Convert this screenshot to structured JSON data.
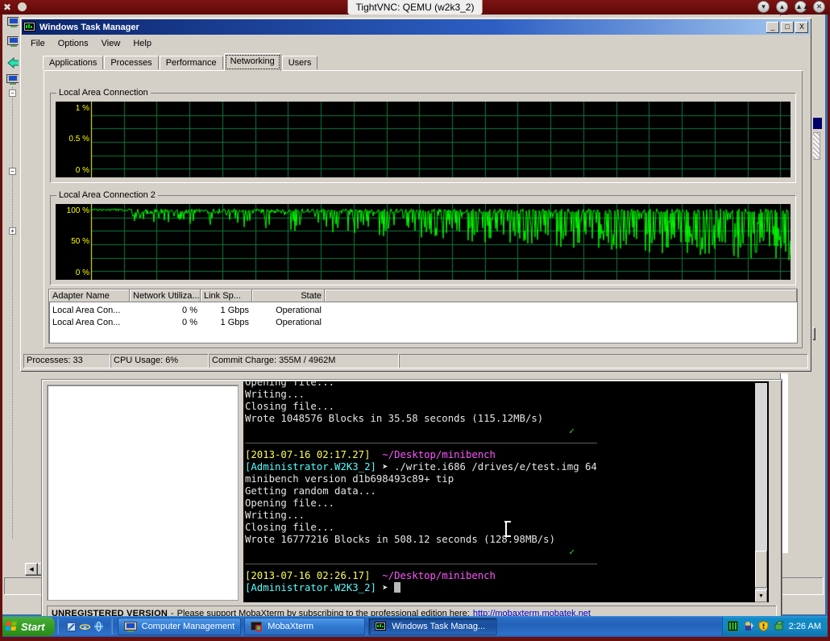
{
  "vnc": {
    "title": "TightVNC: QEMU (w2k3_2)",
    "buttons": [
      {
        "name": "minimize-icon",
        "glyph": "⌄"
      },
      {
        "name": "restore-icon",
        "glyph": "⌃"
      },
      {
        "name": "fullscreen-icon",
        "glyph": "»"
      },
      {
        "name": "close-icon",
        "glyph": "✕"
      }
    ]
  },
  "taskmgr": {
    "title": "Windows Task Manager",
    "window_buttons": [
      "_",
      "□",
      "X"
    ],
    "menus": [
      "File",
      "Options",
      "View",
      "Help"
    ],
    "tabs": [
      {
        "label": "Applications",
        "active": false
      },
      {
        "label": "Processes",
        "active": false
      },
      {
        "label": "Performance",
        "active": false
      },
      {
        "label": "Networking",
        "active": true
      },
      {
        "label": "Users",
        "active": false
      }
    ],
    "graphs": [
      {
        "title": "Local Area Connection",
        "axis_labels": [
          "1 %",
          "0.5 %",
          "0 %"
        ]
      },
      {
        "title": "Local Area Connection 2",
        "axis_labels": [
          "100 %",
          "50 %",
          "0 %"
        ]
      }
    ],
    "adapter_table": {
      "columns": [
        "Adapter Name",
        "Network Utiliza...",
        "Link Sp...",
        "State",
        ""
      ],
      "rows": [
        [
          "Local Area Con...",
          "0 %",
          "1 Gbps",
          "Operational",
          ""
        ],
        [
          "Local Area Con...",
          "0 %",
          "1 Gbps",
          "Operational",
          ""
        ]
      ]
    },
    "status": [
      "Processes: 33",
      "CPU Usage: 6%",
      "Commit Charge: 355M / 4962M",
      ""
    ]
  },
  "terminal": {
    "lines": [
      {
        "segments": [
          {
            "text": "Opening file...",
            "color": "white"
          }
        ]
      },
      {
        "segments": [
          {
            "text": "Writing...",
            "color": "white"
          }
        ]
      },
      {
        "segments": [
          {
            "text": "Closing file...",
            "color": "white"
          }
        ]
      },
      {
        "segments": [
          {
            "text": "Wrote 1048576 Blocks in 35.58 seconds (115.12MB/s)",
            "color": "white"
          }
        ]
      },
      {
        "segments": [],
        "tick": true
      },
      {
        "separator": true
      },
      {
        "segments": [
          {
            "text": "[2013-07-16 02:17.27]",
            "color": "yellow"
          },
          {
            "text": "  ",
            "color": "white"
          },
          {
            "text": "~/Desktop/minibench",
            "color": "magenta"
          }
        ]
      },
      {
        "segments": [
          {
            "text": "[Administrator.W2K3_2]",
            "color": "cyan"
          },
          {
            "text": " ➤ ",
            "color": "white"
          },
          {
            "text": "./write.i686 /drives/e/test.img 64",
            "color": "white"
          }
        ]
      },
      {
        "segments": [
          {
            "text": "minibench version d1b698493c89+ tip",
            "color": "white"
          }
        ]
      },
      {
        "segments": [
          {
            "text": "Getting random data...",
            "color": "white"
          }
        ]
      },
      {
        "segments": [
          {
            "text": "Opening file...",
            "color": "white"
          }
        ]
      },
      {
        "segments": [
          {
            "text": "Writing...",
            "color": "white"
          }
        ]
      },
      {
        "segments": [
          {
            "text": "Closing file...",
            "color": "white"
          }
        ]
      },
      {
        "segments": [
          {
            "text": "Wrote 16777216 Blocks in 508.12 seconds (128.98MB/s)",
            "color": "white"
          }
        ]
      },
      {
        "segments": [],
        "tick": true
      },
      {
        "separator": true
      },
      {
        "segments": [
          {
            "text": "[2013-07-16 02:26.17]",
            "color": "yellow"
          },
          {
            "text": "  ",
            "color": "white"
          },
          {
            "text": "~/Desktop/minibench",
            "color": "magenta"
          }
        ]
      },
      {
        "segments": [
          {
            "text": "[Administrator.W2K3_2]",
            "color": "cyan"
          },
          {
            "text": " ➤ ",
            "color": "white"
          }
        ],
        "cursor": true
      }
    ],
    "tick_glyph": "✓"
  },
  "moba": {
    "status_prefix": "UNREGISTERED VERSION",
    "status_dash": "-",
    "status_text": "Please support MobaXterm by subscribing to the professional edition here:",
    "status_link": "http://mobaxterm.mobatek.net"
  },
  "taskbar": {
    "start_label": "Start",
    "quicklaunch": [
      "show-desktop-icon",
      "internet-explorer-icon",
      "network-globe-icon"
    ],
    "tasks": [
      {
        "label": "Computer Management",
        "icon": "computer-icon",
        "active": false
      },
      {
        "label": "MobaXterm",
        "icon": "mobaxterm-icon",
        "active": false
      },
      {
        "label": "Windows Task Manag...",
        "icon": "taskmgr-icon",
        "active": true
      }
    ],
    "tray_icons": [
      "taskmgr-tray-icon",
      "network-tray-icon",
      "shield-tray-icon",
      "volume-tray-icon"
    ],
    "clock": "2:26 AM"
  },
  "colors": {
    "accent": "#0a246a",
    "face": "#d4d0c8",
    "graph_line": "#00ff00",
    "graph_axis": "#ffff00",
    "graph_grid": "#007700",
    "vnc_frame": "#6b0e0e"
  }
}
